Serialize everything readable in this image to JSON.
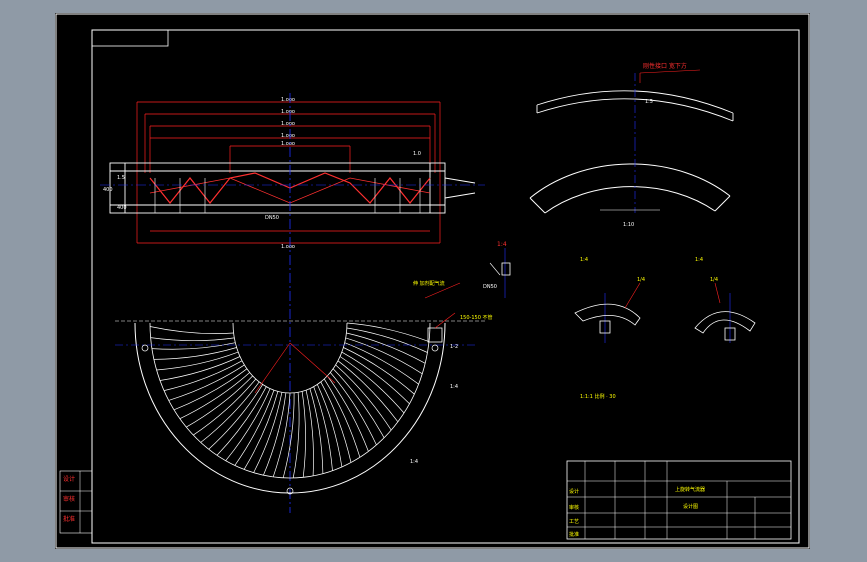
{
  "colors": {
    "background": "#000000",
    "frame": "#ffffff",
    "dimension": "#ff2020",
    "centerline": "#2030ff",
    "leader": "#ff3030",
    "text_label": "#ffff00",
    "window_bg": "#8f9aa6"
  },
  "top_view": {
    "dims": [
      "1.ooo",
      "1.ooo",
      "1.ooo",
      "1.ooo",
      "1.ooo",
      "1.ooo"
    ],
    "side_dims": [
      "400",
      "1.5",
      "400"
    ],
    "section_label": "DN50",
    "right_dim": "1.0"
  },
  "detail_arc": {
    "leader_label": "刚性接口 宽下方",
    "dim_label": "1.5",
    "scale_label": "1:10"
  },
  "small_detail": {
    "label_top": "1:4",
    "label_bottom": "DN50"
  },
  "plan_view": {
    "callout_1": "伸 加剂配气流",
    "callout_2": "150-150 不管",
    "callout_3": "1-2",
    "callout_4": "1:4",
    "callout_5": "1:4"
  },
  "sections": {
    "left_title": "1:4",
    "left_leader": "1/4",
    "right_title": "1:4",
    "right_leader": "1/4",
    "note": "1:1:1 比例 · 30"
  },
  "title_block": {
    "drawing_name": "上旋转气流器",
    "part_name": "设计图",
    "labels": [
      "设计",
      "审核",
      "工艺",
      "批准"
    ]
  },
  "side_stamps": [
    "设计",
    "审核",
    "批准"
  ]
}
